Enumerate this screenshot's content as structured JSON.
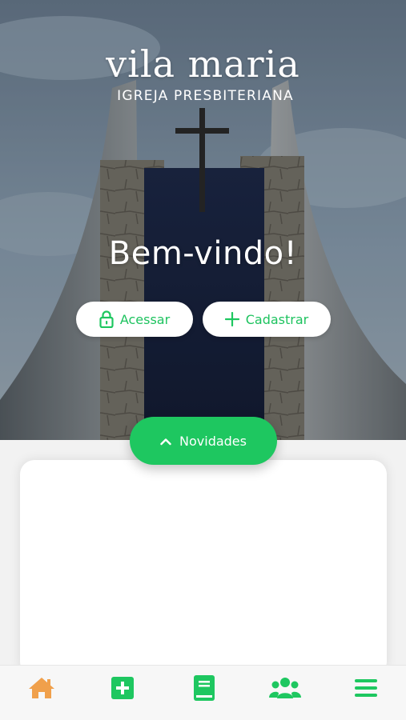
{
  "brand": {
    "title": "vila maria",
    "subtitle": "IGREJA PRESBITERIANA"
  },
  "hero": {
    "welcome": "Bem-vindo!"
  },
  "actions": {
    "login_label": "Acessar",
    "register_label": "Cadastrar"
  },
  "news": {
    "toggle_label": "Novidades"
  },
  "bottom_nav": {
    "items": [
      {
        "icon": "home-icon",
        "color": "#f0a04b",
        "active": true
      },
      {
        "icon": "plus-square-icon",
        "color": "#1ec760"
      },
      {
        "icon": "book-icon",
        "color": "#1ec760"
      },
      {
        "icon": "users-icon",
        "color": "#1ec760"
      },
      {
        "icon": "menu-icon",
        "color": "#1ec760"
      }
    ]
  },
  "colors": {
    "accent": "#1ec760",
    "home_active": "#f0a04b",
    "text_on_dark": "#ffffff"
  }
}
